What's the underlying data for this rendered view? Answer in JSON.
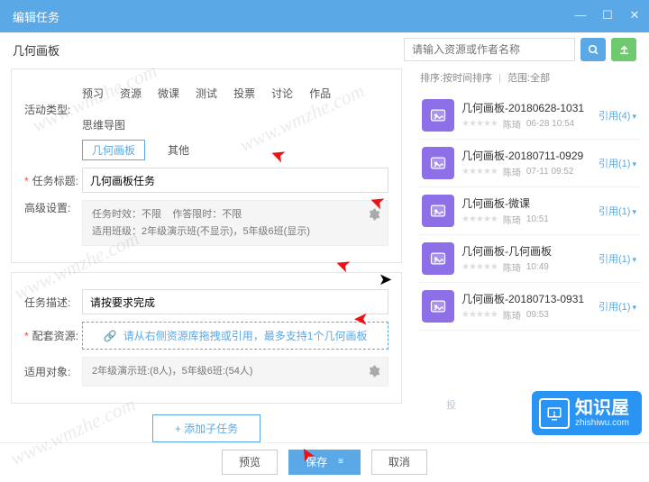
{
  "window": {
    "title": "编辑任务"
  },
  "subheader": {
    "title": "几何画板"
  },
  "search": {
    "placeholder": "请输入资源或作者名称"
  },
  "filterline": {
    "sort": "排序:按时间排序",
    "scope": "范围:全部"
  },
  "activity": {
    "label": "活动类型:",
    "tabs": [
      "预习",
      "资源",
      "微课",
      "测试",
      "投票",
      "讨论",
      "作品",
      "思维导图"
    ],
    "pill_selected": "几何画板",
    "pill_other": "其他"
  },
  "task_title": {
    "label": "任务标题:",
    "value": "几何画板任务"
  },
  "advanced": {
    "label": "高级设置:",
    "line1a": "任务时效：不限",
    "line1b": "作答限时：不限",
    "line2": "适用班级：2年级演示班(不显示)，5年级6班(显示)"
  },
  "desc": {
    "label": "任务描述:",
    "value": "请按要求完成"
  },
  "resource": {
    "label": "配套资源:",
    "hint": "请从右侧资源库拖拽或引用，最多支持1个几何画板"
  },
  "target": {
    "label": "适用对象:",
    "value": "2年级演示班:(8人)，5年级6班:(54人)"
  },
  "add_sub": "+ 添加子任务",
  "footer": {
    "preview": "预览",
    "save": "保存",
    "cancel": "取消"
  },
  "resources": [
    {
      "title": "几何画板-20180628-1031",
      "author": "陈琦",
      "time": "06-28 10:54",
      "quote": "引用(4)"
    },
    {
      "title": "几何画板-20180711-0929",
      "author": "陈琦",
      "time": "07-11 09:52",
      "quote": "引用(1)"
    },
    {
      "title": "几何画板-微课",
      "author": "陈琦",
      "time": "10:51",
      "quote": "引用(1)"
    },
    {
      "title": "几何画板-几何画板",
      "author": "陈琦",
      "time": "10:49",
      "quote": "引用(1)"
    },
    {
      "title": "几何画板-20180713-0931",
      "author": "陈琦",
      "time": "09:53",
      "quote": "引用(1)"
    }
  ],
  "recommend": "投",
  "brand": {
    "name": "知识屋",
    "url": "zhishiwu.com"
  },
  "watermark": "www.wmzhe.com"
}
